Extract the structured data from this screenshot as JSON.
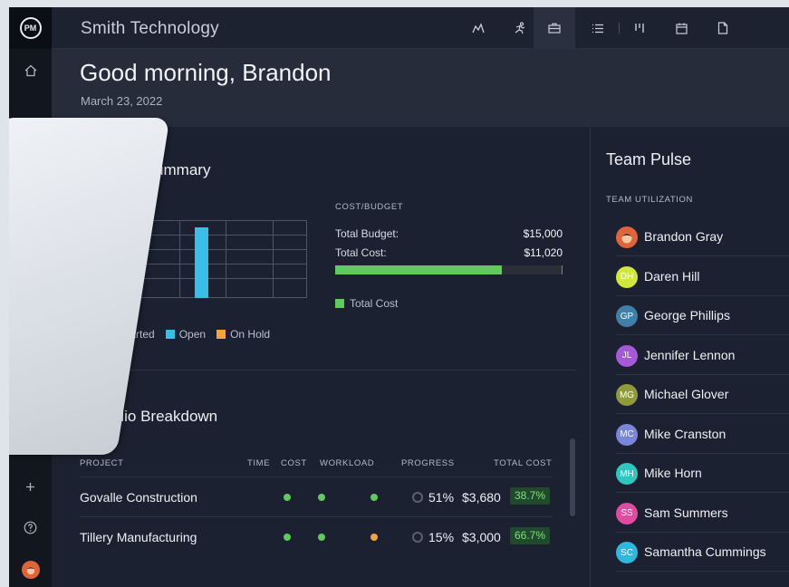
{
  "app": {
    "title": "Smith Technology",
    "logo": "PM"
  },
  "topbar_icons": [
    "people-icon",
    "running-person-icon",
    "briefcase-icon",
    "list-icon",
    "board-icon",
    "calendar-icon",
    "document-icon"
  ],
  "greeting": {
    "title": "Good morning, Brandon",
    "date": "March 23, 2022"
  },
  "portfolio_summary": {
    "title": "lio Summary",
    "status_label": "E",
    "legend": [
      {
        "label": "Not Started",
        "color": "#9aa0ad"
      },
      {
        "label": "Open",
        "color": "#39bfe6"
      },
      {
        "label": "On Hold",
        "color": "#f0a63a"
      }
    ],
    "chart": {
      "type": "bar",
      "highlight_color": "#39bfe6"
    }
  },
  "cost_budget": {
    "label": "COST/BUDGET",
    "total_budget_label": "Total Budget:",
    "total_budget": "$15,000",
    "total_cost_label": "Total Cost:",
    "total_cost": "$11,020",
    "progress_fraction": 0.734,
    "legend_label": "Total Cost",
    "legend_color": "#5fcb5b"
  },
  "portfolio_breakdown": {
    "title": "Portfolio Breakdown",
    "columns": [
      "PROJECT",
      "TIME",
      "COST",
      "WORKLOAD",
      "PROGRESS",
      "TOTAL COST"
    ],
    "rows": [
      {
        "project": "Govalle Construction",
        "time": "#5fcb5b",
        "cost": "#5fcb5b",
        "workload": "#5fcb5b",
        "progress": "51%",
        "total_cost": "$3,680",
        "variance": "38.7%"
      },
      {
        "project": "Tillery Manufacturing",
        "time": "#5fcb5b",
        "cost": "#5fcb5b",
        "workload": "#f0a63a",
        "progress": "15%",
        "total_cost": "$3,000",
        "variance": "66.7%"
      }
    ]
  },
  "team_pulse": {
    "title": "Team Pulse",
    "label": "TEAM UTILIZATION",
    "members": [
      {
        "name": "Brandon Gray",
        "initials": "",
        "color": "#e0643a"
      },
      {
        "name": "Daren Hill",
        "initials": "DH",
        "color": "#cfe83a"
      },
      {
        "name": "George Phillips",
        "initials": "GP",
        "color": "#3f7fa8"
      },
      {
        "name": "Jennifer Lennon",
        "initials": "JL",
        "color": "#a45ad6"
      },
      {
        "name": "Michael Glover",
        "initials": "MG",
        "color": "#8f9a3a"
      },
      {
        "name": "Mike Cranston",
        "initials": "MC",
        "color": "#7a86d9"
      },
      {
        "name": "Mike Horn",
        "initials": "MH",
        "color": "#2fc6c0"
      },
      {
        "name": "Sam Summers",
        "initials": "SS",
        "color": "#e04aa0"
      },
      {
        "name": "Samantha Cummings",
        "initials": "SC",
        "color": "#2fb7e0"
      }
    ]
  }
}
